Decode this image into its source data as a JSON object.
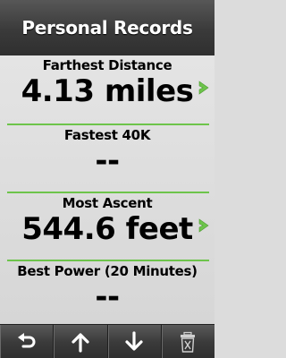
{
  "header": {
    "title": "Personal Records"
  },
  "records": [
    {
      "label": "Farthest Distance",
      "value": "4.13 miles",
      "has_detail": true
    },
    {
      "label": "Fastest 40K",
      "value": "--",
      "has_detail": false
    },
    {
      "label": "Most Ascent",
      "value": "544.6 feet",
      "has_detail": true
    },
    {
      "label": "Best Power (20 Minutes)",
      "value": "--",
      "has_detail": false
    }
  ],
  "toolbar": {
    "buttons": [
      {
        "icon": "back-icon"
      },
      {
        "icon": "arrow-up-icon"
      },
      {
        "icon": "arrow-down-icon"
      },
      {
        "icon": "trash-icon"
      }
    ]
  },
  "colors": {
    "accent": "#6dc44b",
    "header_bg": "#3a3a3a",
    "list_bg": "#dcdcdc"
  }
}
